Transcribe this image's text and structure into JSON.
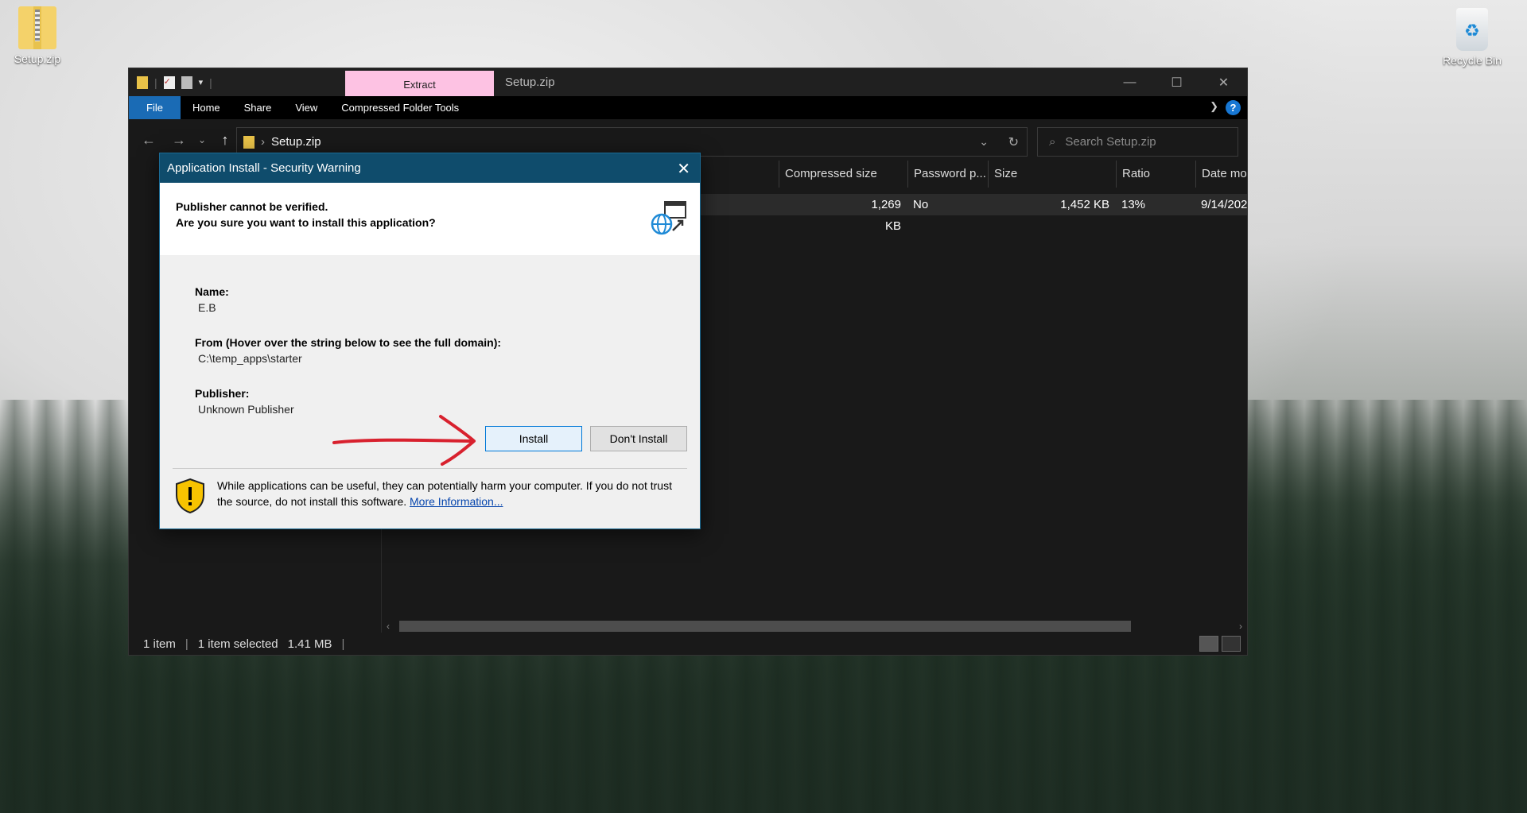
{
  "desktop": {
    "icons": [
      {
        "label": "Setup.zip",
        "icon": "zip-folder-icon"
      },
      {
        "label": "Recycle Bin",
        "icon": "recycle-bin-icon"
      }
    ]
  },
  "explorer": {
    "context_tab": "Extract",
    "window_title": "Setup.zip",
    "ribbon_tabs": [
      "File",
      "Home",
      "Share",
      "View",
      "Compressed Folder Tools"
    ],
    "address_path": "Setup.zip",
    "search_placeholder": "Search Setup.zip",
    "columns": [
      "Compressed size",
      "Password p...",
      "Size",
      "Ratio",
      "Date mo"
    ],
    "row": {
      "compressed_size": "1,269 KB",
      "password": "No",
      "size": "1,452 KB",
      "ratio": "13%",
      "date": "9/14/202"
    },
    "status": {
      "items": "1 item",
      "selected": "1 item selected",
      "size": "1.41 MB"
    },
    "colors": {
      "accent": "#1a6bb5",
      "context_tab": "#fdc2e3"
    }
  },
  "dialog": {
    "title": "Application Install - Security Warning",
    "headline1": "Publisher cannot be verified.",
    "headline2": "Are you sure you want to install this application?",
    "name_label": "Name:",
    "name_value": "E.B",
    "from_label": "From (Hover over the string below to see the full domain):",
    "from_value": "C:\\temp_apps\\starter",
    "publisher_label": "Publisher:",
    "publisher_value": "Unknown Publisher",
    "install_label": "Install",
    "dont_install_label": "Don't Install",
    "warning_text": "While applications can be useful, they can potentially harm your computer. If you do not trust the source, do not install this software.",
    "more_info_label": "More Information...",
    "colors": {
      "title_bar": "#0f4c6c",
      "annotation_arrow": "#d8212e"
    }
  }
}
